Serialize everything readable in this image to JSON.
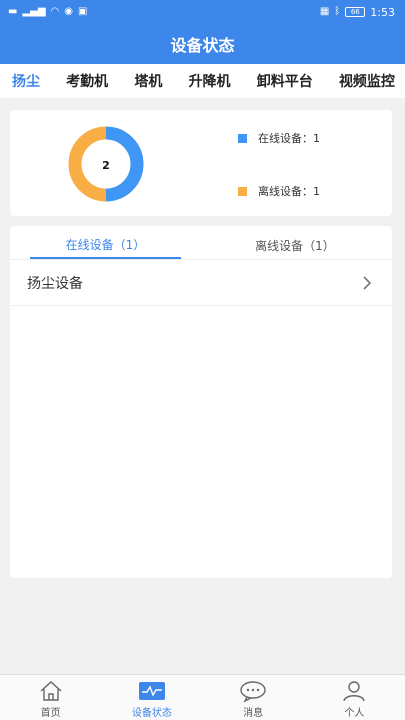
{
  "status_bar": {
    "time": "1:53",
    "battery": "66"
  },
  "header": {
    "title": "设备状态"
  },
  "category_tabs": [
    "扬尘",
    "考勤机",
    "塔机",
    "升降机",
    "卸料平台",
    "视频监控"
  ],
  "summary": {
    "total": "2",
    "legend": [
      {
        "label": "在线设备：",
        "count": "1",
        "color": "#4096f4"
      },
      {
        "label": "离线设备：",
        "count": "1",
        "color": "#f9ae45"
      }
    ]
  },
  "chart_data": {
    "type": "pie",
    "values": [
      1,
      1
    ],
    "categories": [
      "在线设备",
      "离线设备"
    ],
    "colors": [
      "#4096f4",
      "#f9ae45"
    ],
    "center_label": "2"
  },
  "list": {
    "tabs": [
      {
        "label": "在线设备（1）"
      },
      {
        "label": "离线设备（1）"
      }
    ],
    "rows": [
      {
        "label": "扬尘设备"
      }
    ]
  },
  "bottom_nav": [
    {
      "label": "首页",
      "icon": "home-icon"
    },
    {
      "label": "设备状态",
      "icon": "pulse-icon"
    },
    {
      "label": "消息",
      "icon": "message-icon"
    },
    {
      "label": "个人",
      "icon": "person-icon"
    }
  ],
  "colors": {
    "primary": "#3d86ea",
    "online": "#4096f4",
    "offline": "#f9ae45"
  }
}
